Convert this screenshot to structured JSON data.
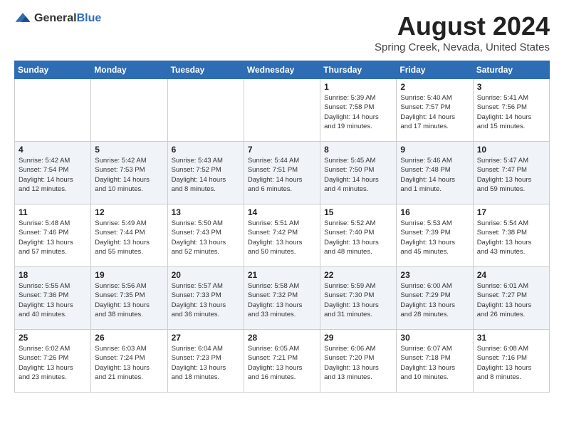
{
  "header": {
    "logo_general": "General",
    "logo_blue": "Blue",
    "month": "August 2024",
    "location": "Spring Creek, Nevada, United States"
  },
  "weekdays": [
    "Sunday",
    "Monday",
    "Tuesday",
    "Wednesday",
    "Thursday",
    "Friday",
    "Saturday"
  ],
  "weeks": [
    [
      {
        "day": "",
        "text": ""
      },
      {
        "day": "",
        "text": ""
      },
      {
        "day": "",
        "text": ""
      },
      {
        "day": "",
        "text": ""
      },
      {
        "day": "1",
        "text": "Sunrise: 5:39 AM\nSunset: 7:58 PM\nDaylight: 14 hours\nand 19 minutes."
      },
      {
        "day": "2",
        "text": "Sunrise: 5:40 AM\nSunset: 7:57 PM\nDaylight: 14 hours\nand 17 minutes."
      },
      {
        "day": "3",
        "text": "Sunrise: 5:41 AM\nSunset: 7:56 PM\nDaylight: 14 hours\nand 15 minutes."
      }
    ],
    [
      {
        "day": "4",
        "text": "Sunrise: 5:42 AM\nSunset: 7:54 PM\nDaylight: 14 hours\nand 12 minutes."
      },
      {
        "day": "5",
        "text": "Sunrise: 5:42 AM\nSunset: 7:53 PM\nDaylight: 14 hours\nand 10 minutes."
      },
      {
        "day": "6",
        "text": "Sunrise: 5:43 AM\nSunset: 7:52 PM\nDaylight: 14 hours\nand 8 minutes."
      },
      {
        "day": "7",
        "text": "Sunrise: 5:44 AM\nSunset: 7:51 PM\nDaylight: 14 hours\nand 6 minutes."
      },
      {
        "day": "8",
        "text": "Sunrise: 5:45 AM\nSunset: 7:50 PM\nDaylight: 14 hours\nand 4 minutes."
      },
      {
        "day": "9",
        "text": "Sunrise: 5:46 AM\nSunset: 7:48 PM\nDaylight: 14 hours\nand 1 minute."
      },
      {
        "day": "10",
        "text": "Sunrise: 5:47 AM\nSunset: 7:47 PM\nDaylight: 13 hours\nand 59 minutes."
      }
    ],
    [
      {
        "day": "11",
        "text": "Sunrise: 5:48 AM\nSunset: 7:46 PM\nDaylight: 13 hours\nand 57 minutes."
      },
      {
        "day": "12",
        "text": "Sunrise: 5:49 AM\nSunset: 7:44 PM\nDaylight: 13 hours\nand 55 minutes."
      },
      {
        "day": "13",
        "text": "Sunrise: 5:50 AM\nSunset: 7:43 PM\nDaylight: 13 hours\nand 52 minutes."
      },
      {
        "day": "14",
        "text": "Sunrise: 5:51 AM\nSunset: 7:42 PM\nDaylight: 13 hours\nand 50 minutes."
      },
      {
        "day": "15",
        "text": "Sunrise: 5:52 AM\nSunset: 7:40 PM\nDaylight: 13 hours\nand 48 minutes."
      },
      {
        "day": "16",
        "text": "Sunrise: 5:53 AM\nSunset: 7:39 PM\nDaylight: 13 hours\nand 45 minutes."
      },
      {
        "day": "17",
        "text": "Sunrise: 5:54 AM\nSunset: 7:38 PM\nDaylight: 13 hours\nand 43 minutes."
      }
    ],
    [
      {
        "day": "18",
        "text": "Sunrise: 5:55 AM\nSunset: 7:36 PM\nDaylight: 13 hours\nand 40 minutes."
      },
      {
        "day": "19",
        "text": "Sunrise: 5:56 AM\nSunset: 7:35 PM\nDaylight: 13 hours\nand 38 minutes."
      },
      {
        "day": "20",
        "text": "Sunrise: 5:57 AM\nSunset: 7:33 PM\nDaylight: 13 hours\nand 36 minutes."
      },
      {
        "day": "21",
        "text": "Sunrise: 5:58 AM\nSunset: 7:32 PM\nDaylight: 13 hours\nand 33 minutes."
      },
      {
        "day": "22",
        "text": "Sunrise: 5:59 AM\nSunset: 7:30 PM\nDaylight: 13 hours\nand 31 minutes."
      },
      {
        "day": "23",
        "text": "Sunrise: 6:00 AM\nSunset: 7:29 PM\nDaylight: 13 hours\nand 28 minutes."
      },
      {
        "day": "24",
        "text": "Sunrise: 6:01 AM\nSunset: 7:27 PM\nDaylight: 13 hours\nand 26 minutes."
      }
    ],
    [
      {
        "day": "25",
        "text": "Sunrise: 6:02 AM\nSunset: 7:26 PM\nDaylight: 13 hours\nand 23 minutes."
      },
      {
        "day": "26",
        "text": "Sunrise: 6:03 AM\nSunset: 7:24 PM\nDaylight: 13 hours\nand 21 minutes."
      },
      {
        "day": "27",
        "text": "Sunrise: 6:04 AM\nSunset: 7:23 PM\nDaylight: 13 hours\nand 18 minutes."
      },
      {
        "day": "28",
        "text": "Sunrise: 6:05 AM\nSunset: 7:21 PM\nDaylight: 13 hours\nand 16 minutes."
      },
      {
        "day": "29",
        "text": "Sunrise: 6:06 AM\nSunset: 7:20 PM\nDaylight: 13 hours\nand 13 minutes."
      },
      {
        "day": "30",
        "text": "Sunrise: 6:07 AM\nSunset: 7:18 PM\nDaylight: 13 hours\nand 10 minutes."
      },
      {
        "day": "31",
        "text": "Sunrise: 6:08 AM\nSunset: 7:16 PM\nDaylight: 13 hours\nand 8 minutes."
      }
    ]
  ]
}
